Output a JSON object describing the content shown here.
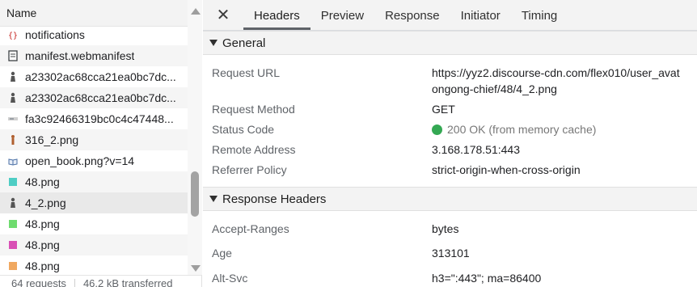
{
  "network_list": {
    "column_name": "Name",
    "rows": [
      {
        "name": "notifications",
        "icon": "json-icon",
        "icon_color": "#c5221f"
      },
      {
        "name": "manifest.webmanifest",
        "icon": "document-icon",
        "icon_color": "#3c4043"
      },
      {
        "name": "a23302ac68cca21ea0bc7dc...",
        "icon": "chess-image-icon",
        "icon_color": "#555555"
      },
      {
        "name": "a23302ac68cca21ea0bc7dc...",
        "icon": "chess-image-icon",
        "icon_color": "#555555"
      },
      {
        "name": "fa3c92466319bc0c4c47448...",
        "icon": "image-icon",
        "icon_color": "#9aa0a6"
      },
      {
        "name": "316_2.png",
        "icon": "figure-image-icon",
        "icon_color": "#b06030"
      },
      {
        "name": "open_book.png?v=14",
        "icon": "book-image-icon",
        "icon_color": "#4a6fa5"
      },
      {
        "name": "48.png",
        "icon": "image-icon",
        "icon_color": "#4ecdc4"
      },
      {
        "name": "4_2.png",
        "icon": "chess-image-icon",
        "icon_color": "#555555"
      },
      {
        "name": "48.png",
        "icon": "image-icon",
        "icon_color": "#6fdc6f"
      },
      {
        "name": "48.png",
        "icon": "image-icon",
        "icon_color": "#d94fb5"
      },
      {
        "name": "48.png",
        "icon": "image-icon",
        "icon_color": "#f0a860"
      }
    ],
    "status": {
      "requests": "64 requests",
      "transferred": "46.2 kB transferred"
    }
  },
  "detail": {
    "tabs": [
      "Headers",
      "Preview",
      "Response",
      "Initiator",
      "Timing"
    ],
    "active_tab": "Headers",
    "general": {
      "title": "General",
      "request_url_label": "Request URL",
      "request_url_line1": "https://yyz2.discourse-cdn.com/flex010/user_avat",
      "request_url_line2": "ongong-chief/48/4_2.png",
      "request_method_label": "Request Method",
      "request_method": "GET",
      "status_code_label": "Status Code",
      "status_code": "200 OK (from memory cache)",
      "status_color": "#34a853",
      "remote_address_label": "Remote Address",
      "remote_address": "3.168.178.51:443",
      "referrer_policy_label": "Referrer Policy",
      "referrer_policy": "strict-origin-when-cross-origin"
    },
    "response_headers": {
      "title": "Response Headers",
      "accept_ranges_label": "Accept-Ranges",
      "accept_ranges": "bytes",
      "age_label": "Age",
      "age": "313101",
      "alt_svc_label": "Alt-Svc",
      "alt_svc": "h3=\":443\"; ma=86400"
    }
  }
}
